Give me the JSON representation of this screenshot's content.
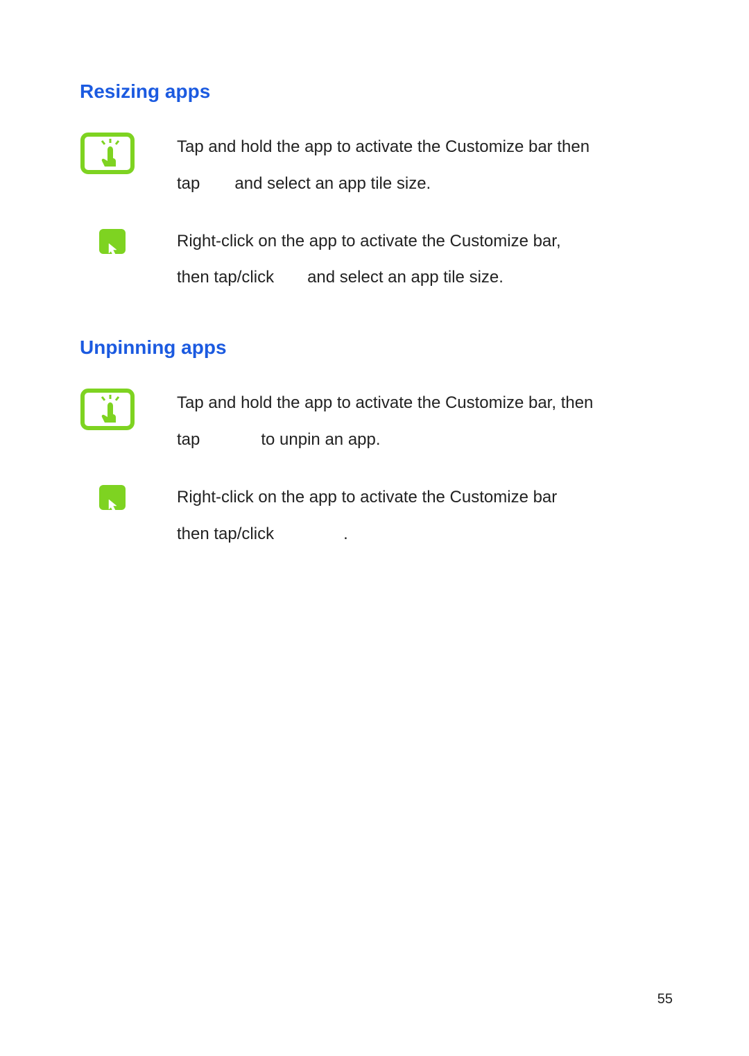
{
  "sections": [
    {
      "heading": "Resizing apps",
      "items": [
        {
          "icon": "touch",
          "text_parts": {
            "l1": "Tap and hold the app to activate the Customize bar then",
            "l2a": "tap",
            "l2b": "and select an app tile size."
          }
        },
        {
          "icon": "mouse",
          "text_parts": {
            "l1": "Right-click on the app to activate the Customize bar,",
            "l2a": "then tap/click",
            "l2b": "and select an app tile size."
          }
        }
      ]
    },
    {
      "heading": "Unpinning apps",
      "items": [
        {
          "icon": "touch",
          "text_parts": {
            "l1": "Tap and hold the app to activate the Customize bar, then",
            "l2a": "tap",
            "l2b": "to unpin an app."
          }
        },
        {
          "icon": "mouse",
          "text_parts": {
            "l1": "Right-click on the app to activate the Customize bar",
            "l2a": "then tap/click",
            "l2b": "."
          }
        }
      ]
    }
  ],
  "page_number": "55",
  "colors": {
    "heading": "#1b5ae0",
    "icon_green": "#7ED321",
    "text": "#222222"
  }
}
